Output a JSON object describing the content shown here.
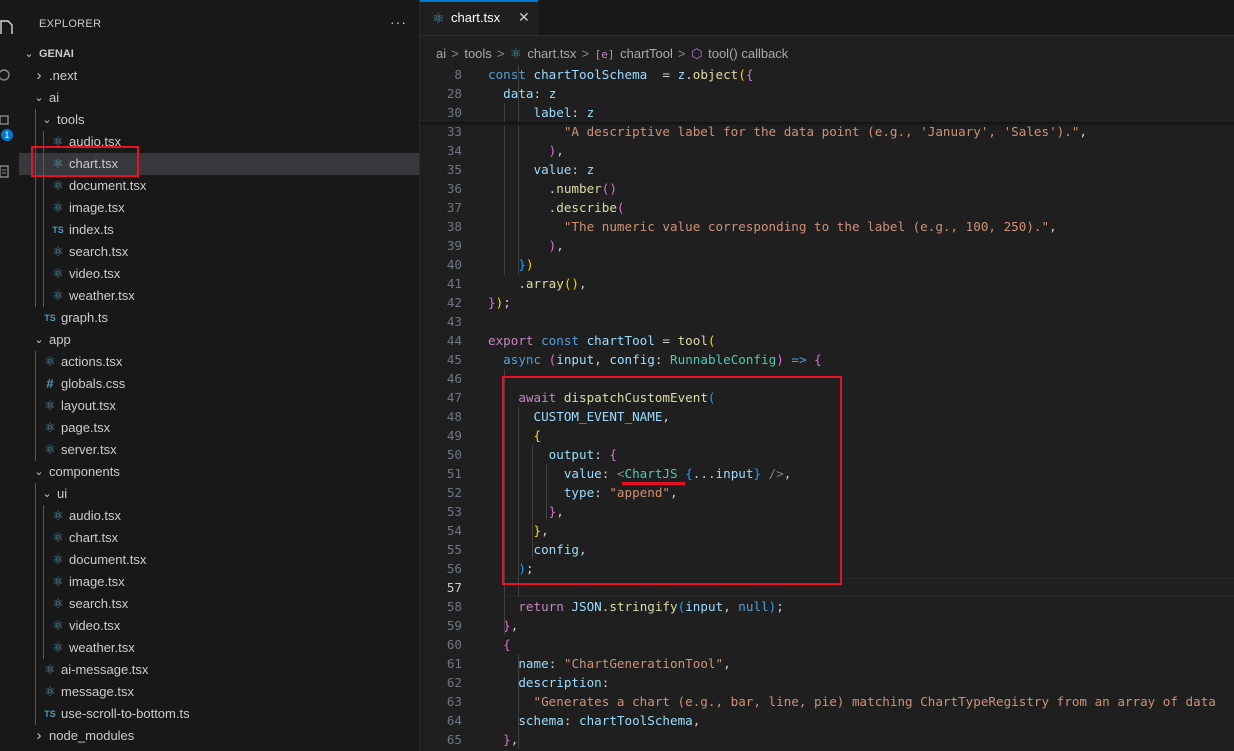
{
  "activity_bar": {
    "badge": "1"
  },
  "explorer": {
    "header": "EXPLORER",
    "more": "···",
    "root": "GENAI",
    "tree": [
      {
        "label": ".next",
        "kind": "folder",
        "depth": 1,
        "expanded": false
      },
      {
        "label": "ai",
        "kind": "folder",
        "depth": 1,
        "expanded": true
      },
      {
        "label": "tools",
        "kind": "folder",
        "depth": 2,
        "expanded": true
      },
      {
        "label": "audio.tsx",
        "kind": "react",
        "depth": 3
      },
      {
        "label": "chart.tsx",
        "kind": "react",
        "depth": 3,
        "selected": true
      },
      {
        "label": "document.tsx",
        "kind": "react",
        "depth": 3
      },
      {
        "label": "image.tsx",
        "kind": "react",
        "depth": 3
      },
      {
        "label": "index.ts",
        "kind": "ts",
        "depth": 3
      },
      {
        "label": "search.tsx",
        "kind": "react",
        "depth": 3
      },
      {
        "label": "video.tsx",
        "kind": "react",
        "depth": 3
      },
      {
        "label": "weather.tsx",
        "kind": "react",
        "depth": 3
      },
      {
        "label": "graph.ts",
        "kind": "ts",
        "depth": 2
      },
      {
        "label": "app",
        "kind": "folder",
        "depth": 1,
        "expanded": true
      },
      {
        "label": "actions.tsx",
        "kind": "react",
        "depth": 2
      },
      {
        "label": "globals.css",
        "kind": "css",
        "depth": 2
      },
      {
        "label": "layout.tsx",
        "kind": "react",
        "depth": 2
      },
      {
        "label": "page.tsx",
        "kind": "react",
        "depth": 2
      },
      {
        "label": "server.tsx",
        "kind": "react",
        "depth": 2
      },
      {
        "label": "components",
        "kind": "folder",
        "depth": 1,
        "expanded": true
      },
      {
        "label": "ui",
        "kind": "folder",
        "depth": 2,
        "expanded": true
      },
      {
        "label": "audio.tsx",
        "kind": "react",
        "depth": 3
      },
      {
        "label": "chart.tsx",
        "kind": "react",
        "depth": 3
      },
      {
        "label": "document.tsx",
        "kind": "react",
        "depth": 3
      },
      {
        "label": "image.tsx",
        "kind": "react",
        "depth": 3
      },
      {
        "label": "search.tsx",
        "kind": "react",
        "depth": 3
      },
      {
        "label": "video.tsx",
        "kind": "react",
        "depth": 3
      },
      {
        "label": "weather.tsx",
        "kind": "react",
        "depth": 3
      },
      {
        "label": "ai-message.tsx",
        "kind": "react",
        "depth": 2
      },
      {
        "label": "message.tsx",
        "kind": "react",
        "depth": 2
      },
      {
        "label": "use-scroll-to-bottom.ts",
        "kind": "ts",
        "depth": 2
      },
      {
        "label": "node_modules",
        "kind": "folder",
        "depth": 1,
        "expanded": false
      }
    ]
  },
  "editor": {
    "tab": {
      "label": "chart.tsx",
      "close": "✕"
    },
    "breadcrumb": [
      "ai",
      "tools",
      "chart.tsx",
      "chartTool",
      "tool() callback"
    ],
    "active_line": "57",
    "lines": [
      {
        "n": "8",
        "t": [
          [
            "kw",
            "const "
          ],
          [
            "var",
            "chartToolSchema"
          ],
          [
            "",
            "  = "
          ],
          [
            "var",
            "z"
          ],
          [
            "",
            "."
          ],
          [
            "fn",
            "object"
          ],
          [
            "br1",
            "("
          ],
          [
            "br2",
            "{"
          ]
        ]
      },
      {
        "n": "28",
        "t": [
          [
            "",
            "  "
          ],
          [
            "var",
            "data"
          ],
          [
            "",
            ": "
          ],
          [
            "var",
            "z"
          ]
        ]
      },
      {
        "n": "30",
        "t": [
          [
            "",
            "      "
          ],
          [
            "var",
            "label"
          ],
          [
            "",
            ": "
          ],
          [
            "var",
            "z"
          ]
        ]
      },
      {
        "n": "33",
        "t": [
          [
            "",
            "          "
          ],
          [
            "str",
            "\"A descriptive label for the data point (e.g., 'January', 'Sales').\""
          ],
          [
            "",
            ","
          ]
        ]
      },
      {
        "n": "34",
        "t": [
          [
            "",
            "        "
          ],
          [
            "br2",
            ")"
          ],
          [
            "",
            ","
          ]
        ]
      },
      {
        "n": "35",
        "t": [
          [
            "",
            "      "
          ],
          [
            "var",
            "value"
          ],
          [
            "",
            ": "
          ],
          [
            "var",
            "z"
          ]
        ]
      },
      {
        "n": "36",
        "t": [
          [
            "",
            "        ."
          ],
          [
            "fn",
            "number"
          ],
          [
            "br2",
            "()"
          ]
        ]
      },
      {
        "n": "37",
        "t": [
          [
            "",
            "        ."
          ],
          [
            "fn",
            "describe"
          ],
          [
            "br2",
            "("
          ]
        ]
      },
      {
        "n": "38",
        "t": [
          [
            "",
            "          "
          ],
          [
            "str",
            "\"The numeric value corresponding to the label (e.g., 100, 250).\""
          ],
          [
            "",
            ","
          ]
        ]
      },
      {
        "n": "39",
        "t": [
          [
            "",
            "        "
          ],
          [
            "br2",
            ")"
          ],
          [
            "",
            ","
          ]
        ]
      },
      {
        "n": "40",
        "t": [
          [
            "",
            "    "
          ],
          [
            "br3",
            "}"
          ],
          [
            "br1",
            ")"
          ]
        ]
      },
      {
        "n": "41",
        "t": [
          [
            "",
            "    ."
          ],
          [
            "fn",
            "array"
          ],
          [
            "br1",
            "()"
          ],
          [
            "",
            ","
          ]
        ]
      },
      {
        "n": "42",
        "t": [
          [
            "br2",
            "}"
          ],
          [
            "br1",
            ")"
          ],
          [
            "",
            ";"
          ]
        ]
      },
      {
        "n": "43",
        "t": []
      },
      {
        "n": "44",
        "t": [
          [
            "ctl",
            "export "
          ],
          [
            "kw",
            "const "
          ],
          [
            "var",
            "chartTool"
          ],
          [
            "",
            " = "
          ],
          [
            "fn",
            "tool"
          ],
          [
            "br1",
            "("
          ]
        ]
      },
      {
        "n": "45",
        "t": [
          [
            "",
            "  "
          ],
          [
            "kw",
            "async "
          ],
          [
            "br2",
            "("
          ],
          [
            "var",
            "input"
          ],
          [
            "",
            ", "
          ],
          [
            "var",
            "config"
          ],
          [
            "",
            ": "
          ],
          [
            "typ",
            "RunnableConfig"
          ],
          [
            "br2",
            ")"
          ],
          [
            "kw",
            " => "
          ],
          [
            "br2",
            "{"
          ]
        ]
      },
      {
        "n": "46",
        "t": []
      },
      {
        "n": "47",
        "t": [
          [
            "",
            "    "
          ],
          [
            "ctl",
            "await "
          ],
          [
            "fn",
            "dispatchCustomEvent"
          ],
          [
            "br3",
            "("
          ]
        ]
      },
      {
        "n": "48",
        "t": [
          [
            "",
            "      "
          ],
          [
            "var",
            "CUSTOM_EVENT_NAME"
          ],
          [
            "",
            ","
          ]
        ]
      },
      {
        "n": "49",
        "t": [
          [
            "",
            "      "
          ],
          [
            "br1",
            "{"
          ]
        ]
      },
      {
        "n": "50",
        "t": [
          [
            "",
            "        "
          ],
          [
            "var",
            "output"
          ],
          [
            "",
            ": "
          ],
          [
            "br2",
            "{"
          ]
        ]
      },
      {
        "n": "51",
        "t": [
          [
            "",
            "          "
          ],
          [
            "var",
            "value"
          ],
          [
            "",
            ": "
          ],
          [
            "tag",
            "<"
          ],
          [
            "jsx",
            "ChartJS"
          ],
          [
            "",
            " "
          ],
          [
            "br3",
            "{"
          ],
          [
            "",
            "..."
          ],
          [
            "var",
            "input"
          ],
          [
            "br3",
            "}"
          ],
          [
            "tag",
            " />"
          ],
          [
            "",
            ","
          ]
        ]
      },
      {
        "n": "52",
        "t": [
          [
            "",
            "          "
          ],
          [
            "var",
            "type"
          ],
          [
            "",
            ": "
          ],
          [
            "str",
            "\"append\""
          ],
          [
            "",
            ","
          ]
        ]
      },
      {
        "n": "53",
        "t": [
          [
            "",
            "        "
          ],
          [
            "br2",
            "}"
          ],
          [
            "",
            ","
          ]
        ]
      },
      {
        "n": "54",
        "t": [
          [
            "",
            "      "
          ],
          [
            "br1",
            "}"
          ],
          [
            "",
            ","
          ]
        ]
      },
      {
        "n": "55",
        "t": [
          [
            "",
            "      "
          ],
          [
            "var",
            "config"
          ],
          [
            "",
            ","
          ]
        ]
      },
      {
        "n": "56",
        "t": [
          [
            "",
            "    "
          ],
          [
            "br3",
            ")"
          ],
          [
            "",
            ";"
          ]
        ]
      },
      {
        "n": "57",
        "t": []
      },
      {
        "n": "58",
        "t": [
          [
            "",
            "    "
          ],
          [
            "ctl",
            "return "
          ],
          [
            "var",
            "JSON"
          ],
          [
            "",
            "."
          ],
          [
            "fn",
            "stringify"
          ],
          [
            "br3",
            "("
          ],
          [
            "var",
            "input"
          ],
          [
            "",
            ", "
          ],
          [
            "kw",
            "null"
          ],
          [
            "br3",
            ")"
          ],
          [
            "",
            ";"
          ]
        ]
      },
      {
        "n": "59",
        "t": [
          [
            "",
            "  "
          ],
          [
            "br2",
            "}"
          ],
          [
            "",
            ","
          ]
        ]
      },
      {
        "n": "60",
        "t": [
          [
            "",
            "  "
          ],
          [
            "br2",
            "{"
          ]
        ]
      },
      {
        "n": "61",
        "t": [
          [
            "",
            "    "
          ],
          [
            "var",
            "name"
          ],
          [
            "",
            ": "
          ],
          [
            "str",
            "\"ChartGenerationTool\""
          ],
          [
            "",
            ","
          ]
        ]
      },
      {
        "n": "62",
        "t": [
          [
            "",
            "    "
          ],
          [
            "var",
            "description"
          ],
          [
            "",
            ":"
          ]
        ]
      },
      {
        "n": "63",
        "t": [
          [
            "",
            "      "
          ],
          [
            "str",
            "\"Generates a chart (e.g., bar, line, pie) matching ChartTypeRegistry from an array of data"
          ]
        ]
      },
      {
        "n": "64",
        "t": [
          [
            "",
            "    "
          ],
          [
            "var",
            "schema"
          ],
          [
            "",
            ": "
          ],
          [
            "var",
            "chartToolSchema"
          ],
          [
            "",
            ","
          ]
        ]
      },
      {
        "n": "65",
        "t": [
          [
            "",
            "  "
          ],
          [
            "br2",
            "}"
          ],
          [
            "",
            ","
          ]
        ]
      }
    ]
  }
}
